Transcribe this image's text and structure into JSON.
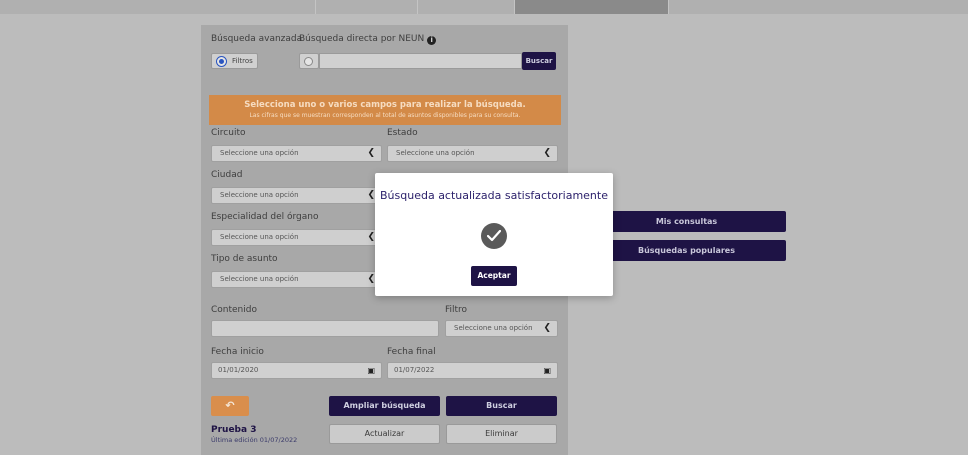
{
  "search": {
    "advanced_label": "Búsqueda avanzada",
    "direct_label": "Búsqueda directa por NEUN",
    "filters_option": "Filtros",
    "neun_value": "",
    "search_button": "Buscar"
  },
  "banner": {
    "title": "Selecciona uno o varios campos para realizar la búsqueda.",
    "subtitle": "Las cifras que se muestran corresponden al total de asuntos disponibles para su consulta."
  },
  "form": {
    "circuit_label": "Circuito",
    "state_label": "Estado",
    "city_label": "Ciudad",
    "specialty_label": "Especialidad del órgano",
    "matter_label": "Tipo de asunto",
    "placeholder": "Seleccione una opción",
    "content_label": "Contenido",
    "content_value": "",
    "filter_label": "Filtro",
    "start_date_label": "Fecha inicio",
    "start_date_value": "01/01/2020",
    "end_date_label": "Fecha final",
    "end_date_value": "01/07/2022"
  },
  "actions": {
    "reset_icon": "undo-icon",
    "expand_label": "Ampliar búsqueda",
    "search_label": "Buscar",
    "update_label": "Actualizar",
    "delete_label": "Eliminar"
  },
  "saved": {
    "name": "Prueba 3",
    "edited": "Última edición 01/07/2022"
  },
  "side": {
    "my_queries": "Mis consultas",
    "popular": "Búsquedas populares"
  },
  "modal": {
    "message": "Búsqueda actualizada satisfactoriamente",
    "icon": "check-icon",
    "accept": "Aceptar"
  },
  "colors": {
    "primary": "#1e1345",
    "accent": "#d98e4c",
    "overlay": "#bcbcbc"
  }
}
